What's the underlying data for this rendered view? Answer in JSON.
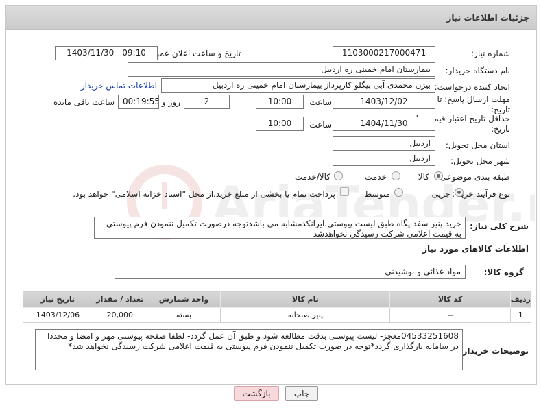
{
  "header": {
    "title": "جزئیات اطلاعات نیاز"
  },
  "need_number": {
    "label": "شماره نیاز:",
    "value": "1103000217000471"
  },
  "announce_datetime": {
    "label": "تاریخ و ساعت اعلان عمومی:",
    "value": "1403/11/30 - 09:10"
  },
  "buyer_org": {
    "label": "نام دستگاه خریدار:",
    "value": "بیمارستان امام خمینی  ره  اردبیل"
  },
  "requester": {
    "label": "ایجاد کننده درخواست:",
    "value": "بیژن محمدی آبی بیگلو کارپرداز بیمارستان امام خمینی  ره  اردبیل",
    "contact_link": "اطلاعات تماس خریدار"
  },
  "deadline": {
    "label_line1": "مهلت ارسال پاسخ: تا",
    "label_line2": "تاریخ:",
    "date": "1403/12/02",
    "time_label": "ساعت",
    "time": "10:00",
    "days": "2",
    "days_label": "روز و",
    "remaining": "00:19:55",
    "remaining_label": "ساعت باقی مانده"
  },
  "price_validity": {
    "label_line1": "حداقل تاریخ اعتبار قیمت: تا",
    "label_line2": "تاریخ:",
    "date": "1404/11/30",
    "time_label": "ساعت",
    "time": "10:00"
  },
  "delivery_province": {
    "label": "استان محل تحویل:",
    "value": "اردبیل"
  },
  "delivery_city": {
    "label": "شهر محل تحویل:",
    "value": "اردبیل"
  },
  "category": {
    "label": "طبقه بندی موضوعی:",
    "options": [
      "کالا",
      "خدمت",
      "کالا/خدمت"
    ],
    "selected": "کالا"
  },
  "purchase_type": {
    "label": "نوع فرآیند خرید :",
    "options": [
      "جزیی",
      "متوسط"
    ],
    "selected": "جزیی",
    "payment_note": "پرداخت تمام یا بخشی از مبلغ خرید،از محل \"اسناد خزانه اسلامی\" خواهد بود."
  },
  "description": {
    "label": "شرح کلی نیاز:",
    "value": "خرید پنیر سفد پگاه طبق لیست پیوستی.ایرانکدمشابه می باشدتوجه درصورت تکمیل ننمودن فرم پیوستی به قیمت اعلامی شرکت رسیدگی نخواهدشد"
  },
  "goods_section": {
    "title": "اطلاعات کالاهای مورد نیاز"
  },
  "goods_group": {
    "label": "گروه کالا:",
    "value": "مواد غذائی و نوشیدنی"
  },
  "table": {
    "headers": [
      "ردیف",
      "کد کالا",
      "نام کالا",
      "واحد شمارش",
      "تعداد / مقدار",
      "تاریخ نیاز"
    ],
    "rows": [
      [
        "1",
        "--",
        "پنیر صبحانه",
        "بسته",
        "20,000",
        "1403/12/06"
      ]
    ]
  },
  "buyer_notes": {
    "label": "توضیحات خریدار:",
    "value": "04533251608معجز- لیست پیوستی بدقت مطالعه شود و طبق آن عمل گردد- لطفا صفحه پیوستی مهر و امضا و مجددا در سامانه بارگذاری گردد*توجه در صورت تکمیل ننمودن فرم پیوستی به قیمت اعلامی شرکت رسیدگی نخواهد شد*"
  },
  "buttons": {
    "print": "چاپ",
    "back": "بازگشت"
  },
  "watermark": {
    "text": "AriaTender.neT"
  },
  "colors": {
    "header_bg": "#d3d3d3",
    "link": "#1a3ea8",
    "back_btn": "#f7d9dc",
    "watermark": "#c0392b"
  }
}
